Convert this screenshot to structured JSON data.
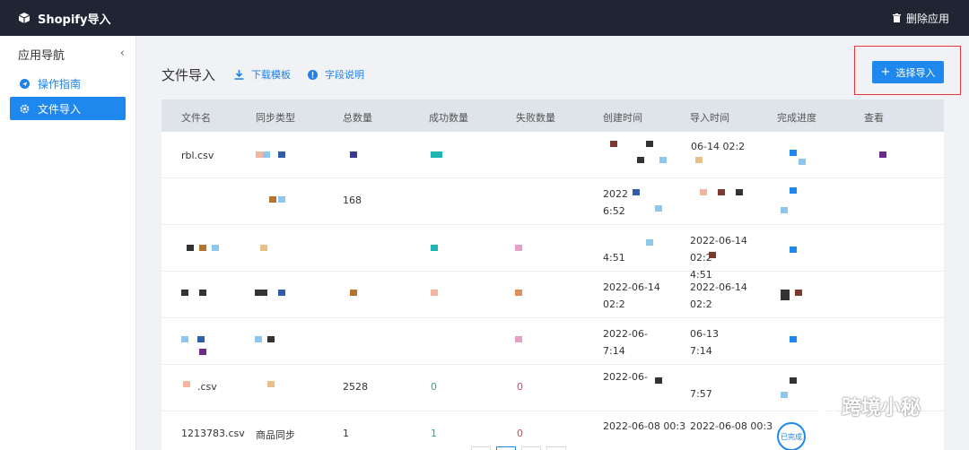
{
  "topbar": {
    "app_title": "Shopify导入",
    "delete_app": "删除应用"
  },
  "sidebar": {
    "title": "应用导航",
    "items": [
      {
        "label": "操作指南",
        "icon": "send-icon",
        "active": false
      },
      {
        "label": "文件导入",
        "icon": "gear-icon",
        "active": true
      }
    ]
  },
  "main": {
    "title": "文件导入",
    "download_template": "下载模板",
    "field_description": "字段说明",
    "select_import": "选择导入"
  },
  "table": {
    "headers": [
      "文件名",
      "同步类型",
      "总数量",
      "成功数量",
      "失败数量",
      "创建时间",
      "导入时间",
      "完成进度",
      "查看"
    ],
    "rows": [
      {
        "file": "rbl.csv",
        "sync": "",
        "total": "",
        "success": "",
        "fail": "",
        "created": "",
        "imported": "06-14 02:2",
        "progress": ""
      },
      {
        "file": "",
        "sync": "",
        "total": "168",
        "success": "",
        "fail": "",
        "created_a": "2022",
        "created_b": "6:52",
        "imported": "",
        "progress": ""
      },
      {
        "file": "",
        "sync": "",
        "total": "",
        "success": "",
        "fail": "",
        "created_a": "",
        "created_b": "4:51",
        "imported_a": "2022-06-14 02:2",
        "imported_b": "4:51",
        "progress": ""
      },
      {
        "file": "",
        "sync": "",
        "total": "",
        "success": "",
        "fail": "",
        "created_a": "2022-06-14 02:2",
        "created_b": "",
        "imported_a": "2022-06-14 02:2",
        "imported_b": "",
        "progress": ""
      },
      {
        "file": "",
        "sync": "",
        "total": "",
        "success": "",
        "fail": "",
        "created_a": "2022-06-",
        "created_b": "7:14",
        "imported_a": "06-13",
        "imported_b": "7:14",
        "progress": ""
      },
      {
        "file": ".csv",
        "sync": "",
        "total": "2528",
        "success": "0",
        "fail": "0",
        "created_a": "2022-06-",
        "created_b": "",
        "imported_a": "",
        "imported_b": "7:57",
        "progress": ""
      },
      {
        "file": "1213783.csv",
        "sync": "商品同步",
        "total": "1",
        "success": "1",
        "fail": "0",
        "created": "2022-06-08 00:3",
        "imported": "2022-06-08 00:3",
        "progress": "已完成"
      }
    ]
  },
  "watermark": {
    "text": "跨境小秘"
  },
  "colors": {
    "topbar": "#1f2533",
    "accent": "#1f88ee",
    "highlight": "#e33b3b",
    "success": "#23b26a",
    "fail": "#e0405a"
  }
}
